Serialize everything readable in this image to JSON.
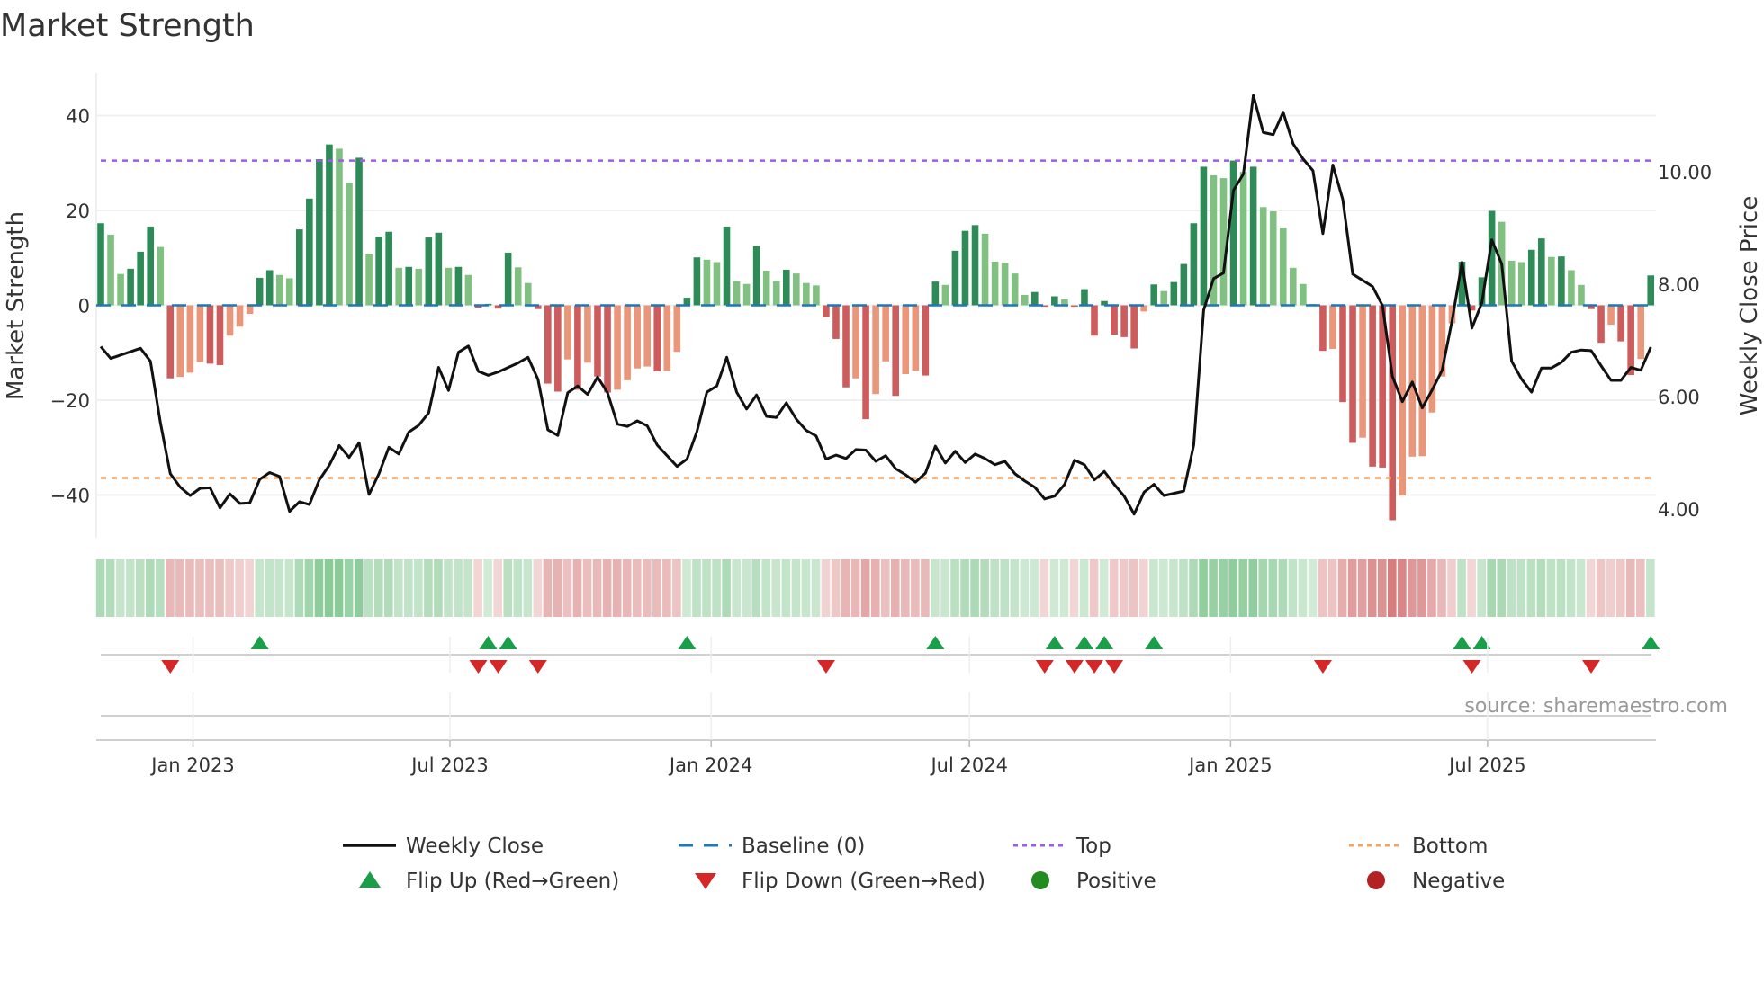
{
  "chart_data": {
    "type": "bar",
    "title": "Market Strength",
    "ylabel": "Market Strength",
    "y2label": "Weekly Close Price",
    "ylim": [
      -49,
      49
    ],
    "y2lim": [
      3.49,
      11.76
    ],
    "yticks": [
      40,
      20,
      0,
      -20,
      -40
    ],
    "ytick_labels": [
      "40",
      "20",
      "0",
      "−20",
      "−40"
    ],
    "y2ticks": [
      10,
      8,
      6,
      4
    ],
    "y2tick_labels": [
      "10.00",
      "8.00",
      "6.00",
      "4.00"
    ],
    "x_start": "2022-10-28",
    "x_step_days": 7,
    "xticks": [
      {
        "date": "2023-01-01",
        "label": "Jan 2023"
      },
      {
        "date": "2023-07-01",
        "label": "Jul 2023"
      },
      {
        "date": "2024-01-01",
        "label": "Jan 2024"
      },
      {
        "date": "2024-07-01",
        "label": "Jul 2024"
      },
      {
        "date": "2025-01-01",
        "label": "Jan 2025"
      },
      {
        "date": "2025-07-01",
        "label": "Jul 2025"
      }
    ],
    "top_threshold": 30.5,
    "bottom_threshold": -36.4,
    "grid": true,
    "legend_position": "bottom",
    "series": [
      {
        "name": "Market Strength",
        "type": "bar",
        "values": [
          17.3,
          14.9,
          6.6,
          7.7,
          11.3,
          16.6,
          12.3,
          -15.4,
          -15.1,
          -14.2,
          -12.0,
          -12.3,
          -12.6,
          -6.4,
          -4.5,
          -1.8,
          5.8,
          7.4,
          6.4,
          5.7,
          16.0,
          22.5,
          30.8,
          33.9,
          33.0,
          25.8,
          31.1,
          10.9,
          14.5,
          15.5,
          7.9,
          8.1,
          7.7,
          14.3,
          15.3,
          7.9,
          8.1,
          6.4,
          -0.5,
          0.3,
          -0.7,
          11.1,
          8.0,
          4.7,
          -0.8,
          -16.5,
          -18.2,
          -11.4,
          -17.8,
          -12.1,
          -15.0,
          -18.4,
          -17.8,
          -15.8,
          -13.3,
          -12.9,
          -13.9,
          -13.8,
          -9.8,
          1.6,
          10.1,
          9.6,
          9.1,
          16.6,
          5.1,
          4.5,
          12.5,
          7.3,
          5.1,
          7.5,
          6.7,
          4.7,
          4.2,
          -2.5,
          -7.1,
          -17.3,
          -15.4,
          -24.0,
          -18.7,
          -11.8,
          -19.1,
          -14.5,
          -13.8,
          -14.8,
          5.0,
          4.3,
          11.5,
          15.7,
          16.9,
          15.1,
          9.2,
          8.9,
          6.7,
          2.2,
          2.8,
          -0.3,
          1.9,
          1.3,
          -0.3,
          3.4,
          -6.4,
          0.9,
          -6.2,
          -6.7,
          -9.1,
          -1.3,
          4.4,
          3.0,
          4.9,
          8.7,
          17.3,
          29.2,
          27.4,
          26.8,
          30.5,
          28.1,
          29.2,
          20.7,
          19.8,
          16.4,
          7.9,
          4.5,
          0.3,
          -9.6,
          -9.2,
          -20.4,
          -29.0,
          -27.9,
          -34.0,
          -34.2,
          -45.3,
          -40.1,
          -31.9,
          -31.8,
          -22.6,
          -15.0,
          -3.8,
          9.2,
          -1.1,
          5.9,
          19.9,
          17.6,
          9.4,
          9.1,
          11.7,
          14.1,
          10.2,
          10.3,
          7.4,
          4.3,
          -0.8,
          -7.9,
          -4.1,
          -7.6,
          -14.7,
          -11.3,
          6.3
        ]
      },
      {
        "name": "Weekly Close",
        "type": "line",
        "axis": "right",
        "values": [
          6.89,
          6.68,
          6.74,
          6.8,
          6.86,
          6.63,
          5.54,
          4.63,
          4.39,
          4.24,
          4.37,
          4.38,
          4.02,
          4.27,
          4.1,
          4.11,
          4.53,
          4.65,
          4.58,
          3.96,
          4.13,
          4.08,
          4.52,
          4.78,
          5.13,
          4.92,
          5.18,
          4.26,
          4.63,
          5.1,
          4.98,
          5.37,
          5.49,
          5.71,
          6.52,
          6.11,
          6.79,
          6.9,
          6.45,
          6.38,
          6.44,
          6.52,
          6.6,
          6.7,
          6.31,
          5.41,
          5.31,
          6.07,
          6.19,
          6.04,
          6.35,
          6.07,
          5.51,
          5.47,
          5.57,
          5.48,
          5.14,
          4.95,
          4.76,
          4.89,
          5.38,
          6.08,
          6.19,
          6.7,
          6.08,
          5.78,
          6.03,
          5.65,
          5.63,
          5.89,
          5.6,
          5.4,
          5.3,
          4.89,
          4.96,
          4.9,
          5.06,
          5.05,
          4.85,
          4.95,
          4.72,
          4.61,
          4.48,
          4.64,
          5.12,
          4.82,
          5.03,
          4.83,
          4.98,
          4.9,
          4.79,
          4.85,
          4.63,
          4.5,
          4.39,
          4.18,
          4.23,
          4.44,
          4.87,
          4.79,
          4.52,
          4.67,
          4.44,
          4.23,
          3.91,
          4.3,
          4.44,
          4.24,
          4.28,
          4.32,
          5.14,
          7.54,
          8.1,
          8.2,
          9.67,
          9.96,
          11.36,
          10.7,
          10.66,
          11.06,
          10.5,
          10.23,
          10.02,
          8.9,
          10.12,
          9.51,
          8.18,
          8.07,
          7.96,
          7.62,
          6.36,
          5.91,
          6.26,
          5.8,
          6.12,
          6.47,
          7.35,
          8.39,
          7.22,
          7.67,
          8.79,
          8.36,
          6.63,
          6.31,
          6.08,
          6.51,
          6.51,
          6.61,
          6.79,
          6.83,
          6.82,
          6.55,
          6.29,
          6.29,
          6.52,
          6.47,
          6.88
        ]
      }
    ],
    "legend": [
      {
        "label": "Weekly Close",
        "kind": "line",
        "color": "#111111"
      },
      {
        "label": "Baseline (0)",
        "kind": "dash",
        "color": "#1f77b4"
      },
      {
        "label": "Top",
        "kind": "dot",
        "color": "#9b5de5"
      },
      {
        "label": "Bottom",
        "kind": "dot",
        "color": "#f4a460"
      },
      {
        "label": "Flip Up (Red→Green)",
        "kind": "tri-up",
        "color": "#1a9e4a"
      },
      {
        "label": "Flip Down (Green→Red)",
        "kind": "tri-down",
        "color": "#d62728"
      },
      {
        "label": "Positive",
        "kind": "circle",
        "color": "#228b22"
      },
      {
        "label": "Negative",
        "kind": "circle",
        "color": "#b22222"
      }
    ],
    "colors": {
      "pos_strong": "#2e8b57",
      "pos_weak": "#80c080",
      "neg_strong": "#cd5c5c",
      "neg_weak": "#e9967a",
      "baseline": "#1f77b4",
      "top": "#9b5de5",
      "bottom": "#f4a460",
      "flip_up": "#1a9e4a",
      "flip_down": "#d62728"
    },
    "source": "source: sharemaestro.com"
  }
}
